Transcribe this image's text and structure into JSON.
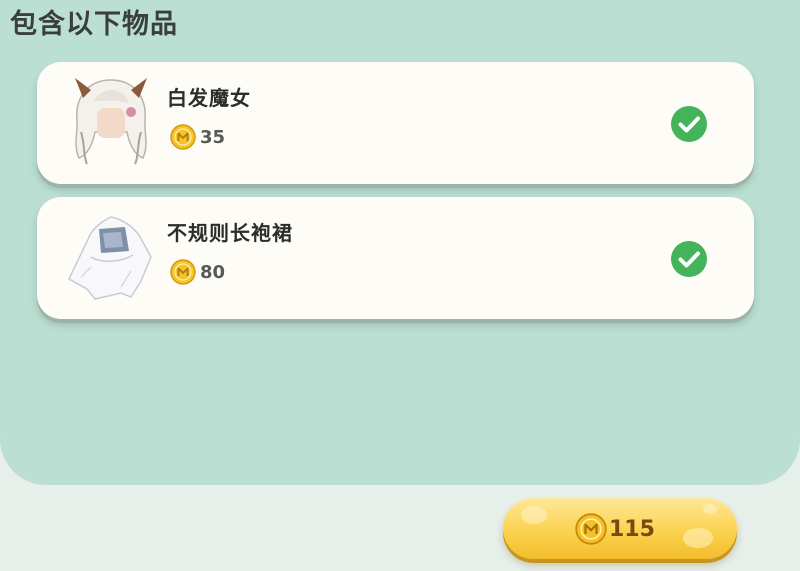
{
  "section": {
    "title": "包含以下物品"
  },
  "items": [
    {
      "name": "白发魔女",
      "price": "35",
      "selected": true
    },
    {
      "name": "不规则长袍裙",
      "price": "80",
      "selected": true
    }
  ],
  "total": {
    "value": "115"
  },
  "icons": {
    "currency": "coin-icon",
    "selected": "check-circle-icon"
  },
  "colors": {
    "panel": "#bcdfd3",
    "card": "#fdfcf7",
    "check": "#44b45a",
    "coin": "#f5c22b",
    "button": "#fcd24e"
  }
}
